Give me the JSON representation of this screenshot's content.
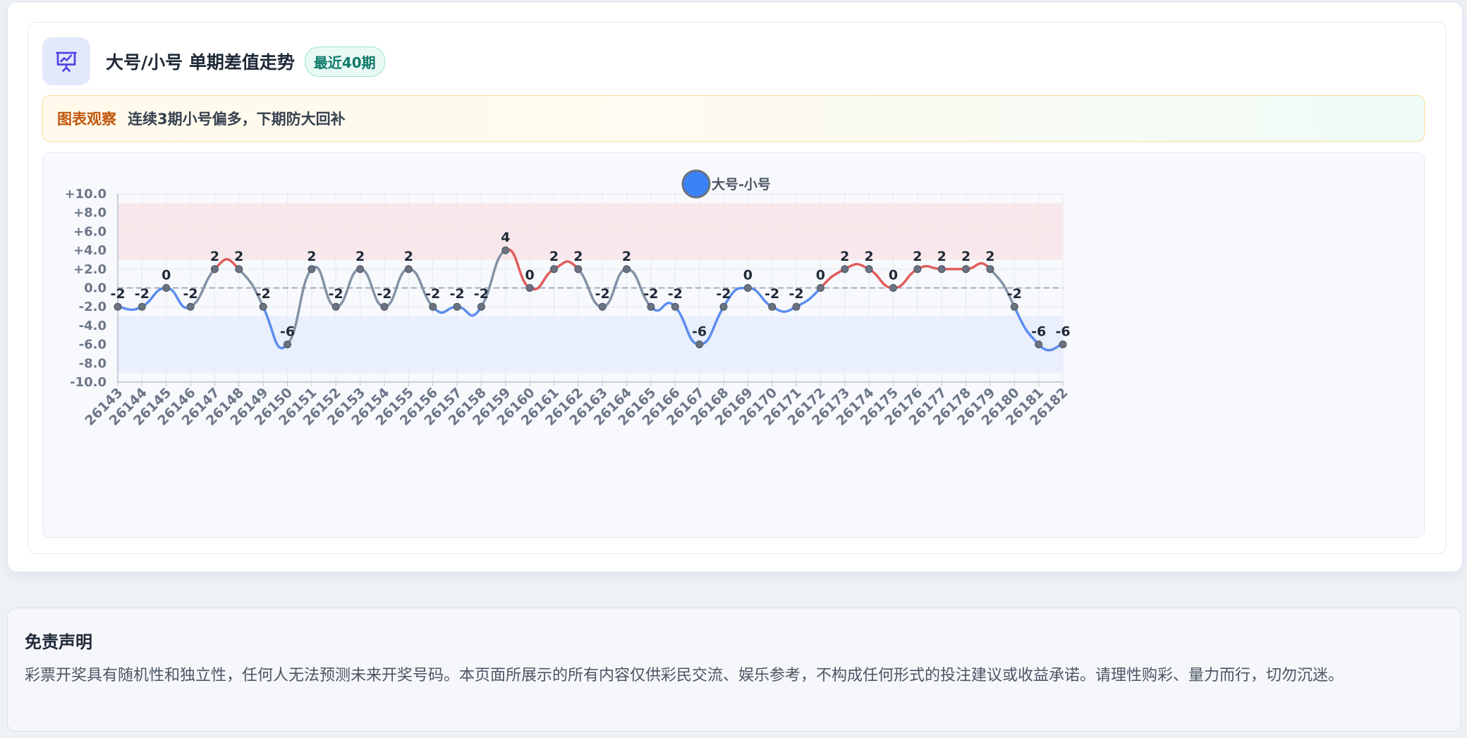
{
  "header": {
    "title": "大号/小号 单期差值走势",
    "badge": "最近40期",
    "icon": "presentation-chart-icon"
  },
  "insight": {
    "label": "图表观察",
    "text": "连续3期小号偏多，下期防大回补"
  },
  "chart_data": {
    "type": "line",
    "title": "",
    "xlabel": "",
    "ylabel": "",
    "legend_position": "top-center",
    "grid": true,
    "ylim": [
      -10,
      10
    ],
    "y_ticks": [
      "+10.0",
      "+8.0",
      "+6.0",
      "+4.0",
      "+2.0",
      "0.0",
      "-2.0",
      "-4.0",
      "-6.0",
      "-8.0",
      "-10.0"
    ],
    "bands": [
      {
        "from": 3,
        "to": 9,
        "color": "#f8e5e8"
      },
      {
        "from": -9,
        "to": -3,
        "color": "#e6edfa"
      }
    ],
    "reference_line": 0,
    "categories": [
      "26143",
      "26144",
      "26145",
      "26146",
      "26147",
      "26148",
      "26149",
      "26150",
      "26151",
      "26152",
      "26153",
      "26154",
      "26155",
      "26156",
      "26157",
      "26158",
      "26159",
      "26160",
      "26161",
      "26162",
      "26163",
      "26164",
      "26165",
      "26166",
      "26167",
      "26168",
      "26169",
      "26170",
      "26171",
      "26172",
      "26173",
      "26174",
      "26175",
      "26176",
      "26177",
      "26178",
      "26179",
      "26180",
      "26181",
      "26182"
    ],
    "series": [
      {
        "name": "大号-小号",
        "values": [
          -2,
          -2,
          0,
          -2,
          2,
          2,
          -2,
          -6,
          2,
          -2,
          2,
          -2,
          2,
          -2,
          -2,
          -2,
          4,
          0,
          2,
          2,
          -2,
          2,
          -2,
          -2,
          -6,
          -2,
          0,
          -2,
          -2,
          0,
          2,
          2,
          0,
          2,
          2,
          2,
          2,
          -2,
          -6,
          -6
        ]
      }
    ],
    "colors": {
      "legend_marker": "#3b82f6",
      "positive": "#e05d5d",
      "negative": "#5b8def",
      "mixed": "#8492a6"
    }
  },
  "disclaimer": {
    "title": "免责声明",
    "text": "彩票开奖具有随机性和独立性，任何人无法预测未来开奖号码。本页面所展示的所有内容仅供彩民交流、娱乐参考，不构成任何形式的投注建议或收益承诺。请理性购彩、量力而行，切勿沉迷。"
  }
}
